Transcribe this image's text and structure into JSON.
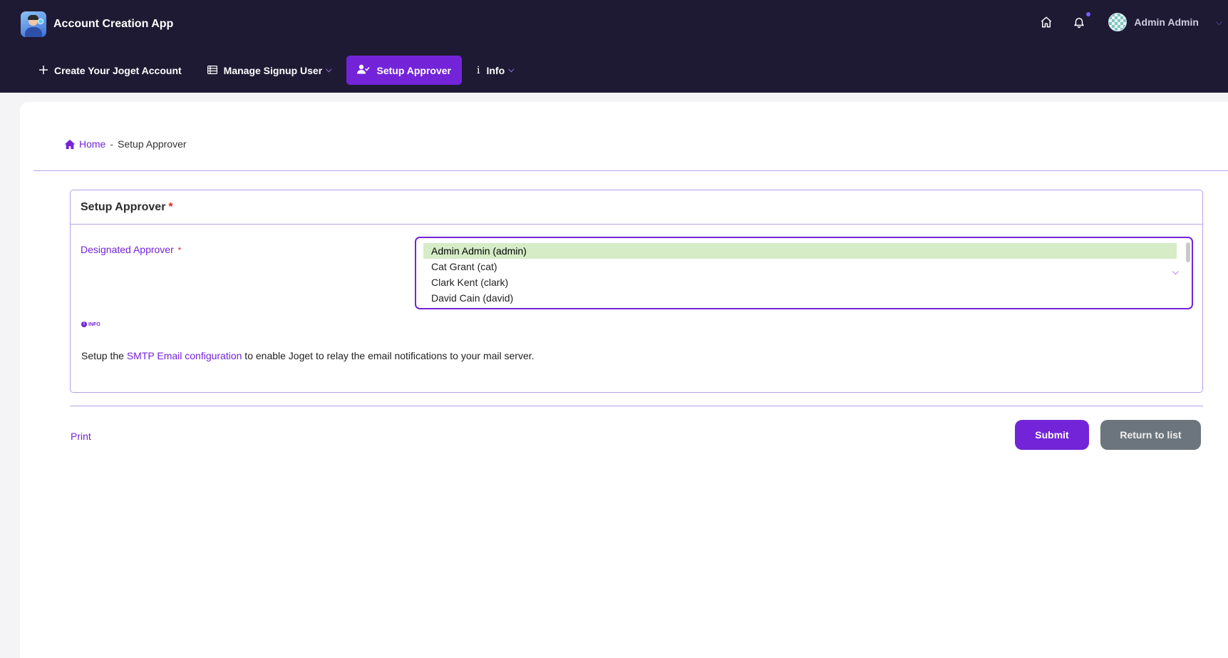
{
  "app": {
    "title": "Account Creation App"
  },
  "header": {
    "user_name": "Admin Admin",
    "icons": {
      "home": "home-icon",
      "notifications": "bell-icon"
    }
  },
  "nav": {
    "items": [
      {
        "label": "Create Your Joget Account",
        "icon": "plus-icon"
      },
      {
        "label": "Manage Signup User",
        "icon": "table-icon"
      },
      {
        "label": "Setup Approver",
        "icon": "user-check-icon",
        "active": true
      },
      {
        "label": "Info",
        "icon": "info-icon"
      }
    ]
  },
  "breadcrumb": {
    "home": "Home",
    "separator": "-",
    "current": "Setup Approver"
  },
  "section": {
    "title": "Setup Approver",
    "required_mark": "*",
    "field_label": "Designated Approver",
    "options": [
      "Admin Admin (admin)",
      "Cat Grant (cat)",
      "Clark Kent (clark)",
      "David Cain (david)"
    ],
    "selected_option": "Admin Admin (admin)",
    "info_tag": "INFO",
    "help_prefix": "Setup the ",
    "help_link": "SMTP Email configuration",
    "help_suffix": " to enable Joget to relay the email notifications to your mail server."
  },
  "actions": {
    "print": "Print",
    "submit": "Submit",
    "return": "Return to list"
  },
  "colors": {
    "accent": "#7324d9",
    "header_bg": "#1e1a33",
    "selected_bg": "#d5ecc6",
    "secondary_button": "#6c757d",
    "required": "#e02424"
  }
}
